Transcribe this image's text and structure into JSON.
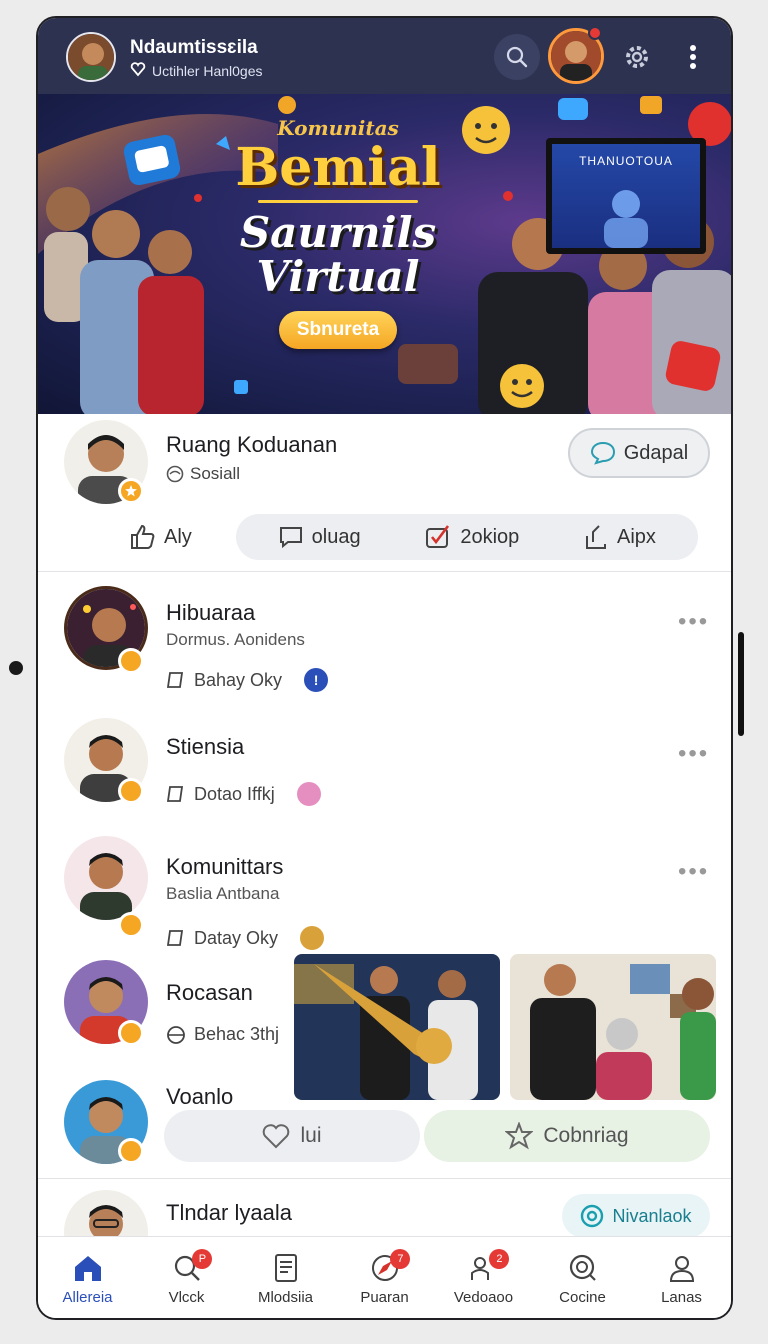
{
  "header": {
    "name": "Ndaumtissɛila",
    "subtitle": "Uctihler Hanl0ges",
    "icons": [
      "search-icon",
      "settings-icon",
      "more-icon"
    ]
  },
  "banner": {
    "small_title": "Komunitas",
    "big_title": "Bemial",
    "mid_title_1": "Saurnils",
    "mid_title_2": "Virtual",
    "pill": "Sbnureta",
    "screen_label": "THANUOTOUA"
  },
  "profile": {
    "name": "Ruang Koduanan",
    "tag": "Sosiall",
    "button": "Gdapal",
    "actions": [
      "Aly",
      "oluag",
      "2okiop",
      "Aipx"
    ]
  },
  "feed": [
    {
      "name": "Hibuaraa",
      "sub": "Dormus. Aonidens",
      "meta": "Bahay Oky"
    },
    {
      "name": "Stiensia",
      "sub": "",
      "meta": "Dotao Iffkj"
    },
    {
      "name": "Komunittars",
      "sub": "Baslia Antbana",
      "meta": "Datay Oky"
    },
    {
      "name": "Rocasan",
      "sub": "",
      "meta": "Behac 3thj"
    },
    {
      "name": "Voanlo",
      "sub": "",
      "meta": ""
    }
  ],
  "reactions": {
    "like": "lui",
    "share": "Cobnriag"
  },
  "last_item": {
    "name": "Tlndar lyaala",
    "button": "Nivanlaok"
  },
  "bottom_nav": [
    {
      "label": "Allereia",
      "badge": ""
    },
    {
      "label": "Vlcck",
      "badge": "P"
    },
    {
      "label": "Mlodsiia",
      "badge": ""
    },
    {
      "label": "Puaran",
      "badge": "7"
    },
    {
      "label": "Vedoaoo",
      "badge": "2"
    },
    {
      "label": "Cocine",
      "badge": ""
    },
    {
      "label": "Lanas",
      "badge": ""
    }
  ],
  "colors": {
    "header": "#2d3250",
    "accent": "#2a4fb8",
    "badge": "#f5a623",
    "alert": "#e53935"
  }
}
